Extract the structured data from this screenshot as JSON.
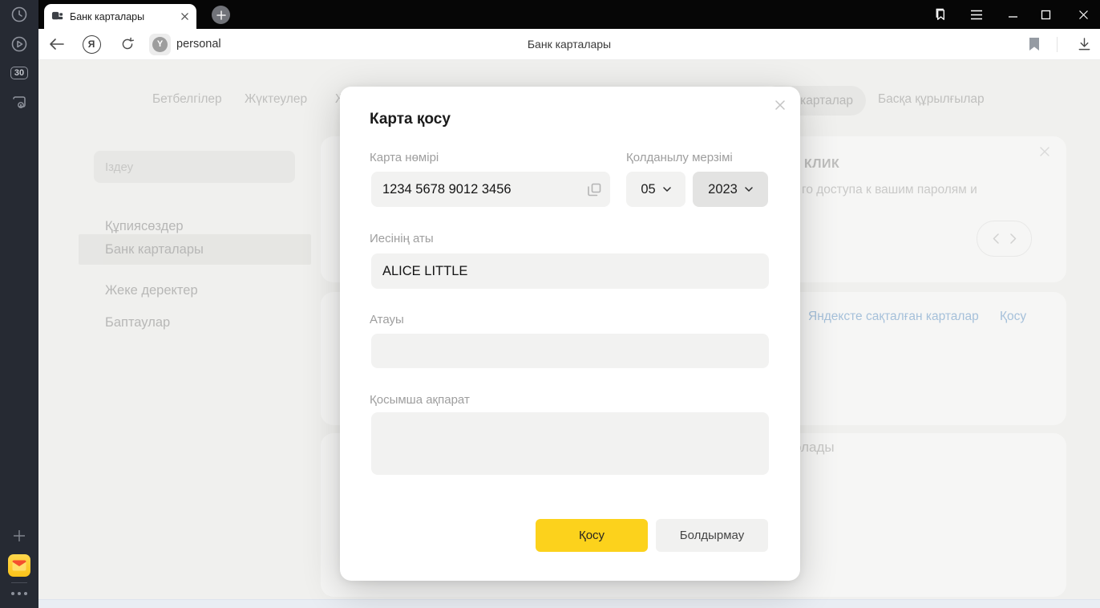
{
  "window": {
    "tab_title": "Банк карталары",
    "tab_count": "30"
  },
  "toolbar": {
    "profile_badge": "personal",
    "page_title": "Банк карталары"
  },
  "icons": {
    "yandex_logo_letter": "Я",
    "protect_letter": "Y"
  },
  "background": {
    "nav_items": [
      "Бетбелгілер",
      "Жүктеулер",
      "Ж",
      "карталар",
      "Басқа құрылғылар"
    ],
    "settings": {
      "search_placeholder": "Іздеу",
      "items": [
        "Құпиясөздер",
        "Банк карталары",
        "Жеке деректер",
        "Баптаулар"
      ]
    },
    "promo": {
      "title": "КЛИК",
      "body": "го доступа к вашим паролям и"
    },
    "saved_cards": {
      "links": [
        "Яндексте сақталған карталар",
        "Қосу"
      ]
    },
    "partial_text": "олады"
  },
  "modal": {
    "title": "Карта қосу",
    "card_number": {
      "label": "Карта нөмірі",
      "value": "1234 5678 9012 3456"
    },
    "expiry": {
      "label": "Қолданылу мерзімі",
      "month": "05",
      "year": "2023"
    },
    "owner": {
      "label": "Иесінің аты",
      "value": "ALICE LITTLE"
    },
    "card_name": {
      "label": "Атауы",
      "value": ""
    },
    "comment": {
      "label": "Қосымша ақпарат",
      "value": ""
    },
    "submit_label": "Қосу",
    "cancel_label": "Болдырмау"
  }
}
